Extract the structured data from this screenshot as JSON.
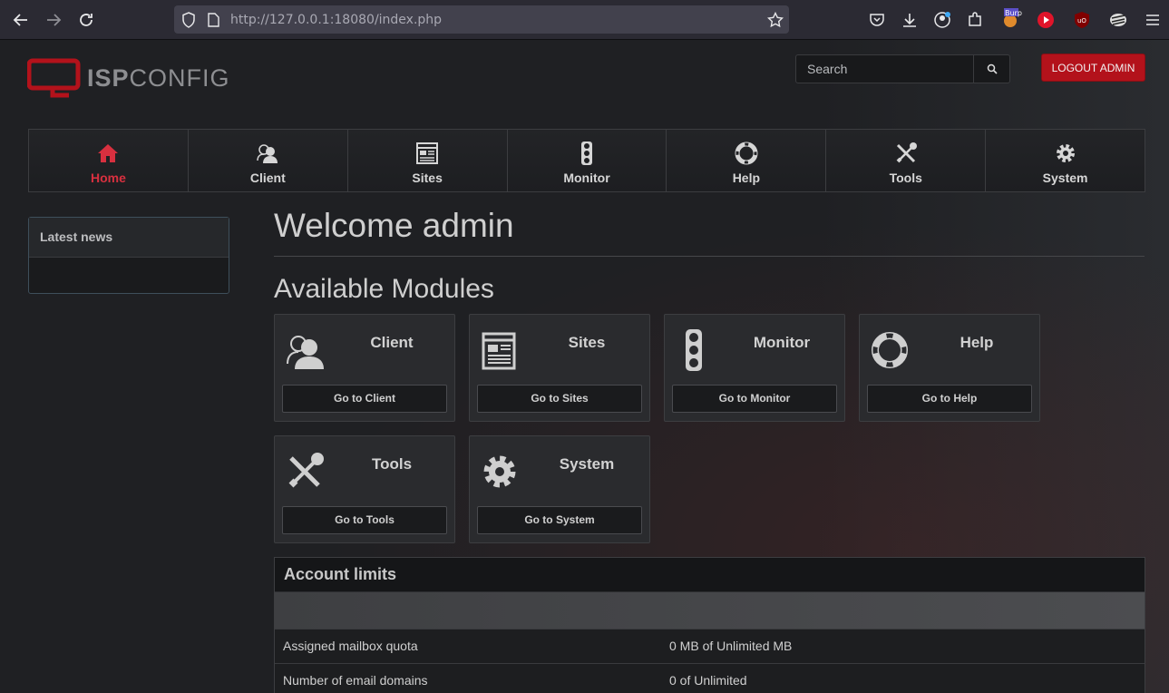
{
  "browser": {
    "url_host": "http://127.0.0.1",
    "url_rest": ":18080/index.php"
  },
  "header": {
    "logo_bold": "ISP",
    "logo_thin": "CONFIG",
    "search_placeholder": "Search",
    "logout_label": "LOGOUT ADMIN"
  },
  "nav": {
    "items": [
      {
        "label": "Home",
        "icon": "home-icon"
      },
      {
        "label": "Client",
        "icon": "users-icon"
      },
      {
        "label": "Sites",
        "icon": "document-list-icon"
      },
      {
        "label": "Monitor",
        "icon": "traffic-light-icon"
      },
      {
        "label": "Help",
        "icon": "lifebuoy-icon"
      },
      {
        "label": "Tools",
        "icon": "wrench-screwdriver-icon"
      },
      {
        "label": "System",
        "icon": "gear-icon"
      }
    ]
  },
  "sidebar": {
    "news_title": "Latest news"
  },
  "main": {
    "welcome": "Welcome admin",
    "modules_title": "Available Modules",
    "modules": [
      {
        "title": "Client",
        "button": "Go to Client"
      },
      {
        "title": "Sites",
        "button": "Go to Sites"
      },
      {
        "title": "Monitor",
        "button": "Go to Monitor"
      },
      {
        "title": "Help",
        "button": "Go to Help"
      },
      {
        "title": "Tools",
        "button": "Go to Tools"
      },
      {
        "title": "System",
        "button": "Go to System"
      }
    ],
    "limits": {
      "title": "Account limits",
      "rows": [
        {
          "label": "Assigned mailbox quota",
          "value": "0 MB of Unlimited MB"
        },
        {
          "label": "Number of email domains",
          "value": "0 of Unlimited"
        }
      ]
    }
  },
  "colors": {
    "accent": "#d8303f",
    "logout_bg": "#b3121b"
  }
}
